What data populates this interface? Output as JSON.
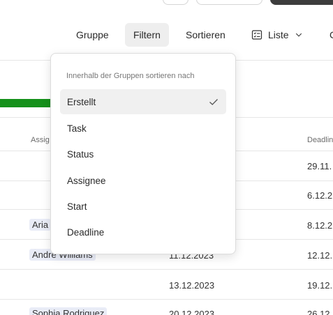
{
  "toolbar": {
    "group_label": "Gruppe",
    "filter_label": "Filtern",
    "sort_label": "Sortieren",
    "view_label": "Liste",
    "view_icon": "list-view-icon",
    "chevron_icon": "chevron-down-icon"
  },
  "table": {
    "headers": {
      "assignee": "Assig",
      "deadline": "Deadlin"
    },
    "rows": [
      {
        "assignee": "",
        "start": "",
        "deadline": "29.11."
      },
      {
        "assignee": "",
        "start": "",
        "deadline": "6.12.2"
      },
      {
        "assignee": "Aria",
        "start": "",
        "deadline": "8.12.2"
      },
      {
        "assignee": "Andre Williams",
        "start": "11.12.2023",
        "deadline": "12.12."
      },
      {
        "assignee": "",
        "start": "13.12.2023",
        "deadline": "19.12."
      },
      {
        "assignee": "Sophia Rodriguez",
        "start": "20.12.2023",
        "deadline": "26.12."
      }
    ]
  },
  "sort_menu": {
    "title": "Innerhalb der Gruppen sortieren nach",
    "items": [
      {
        "label": "Erstellt",
        "selected": true
      },
      {
        "label": "Task",
        "selected": false
      },
      {
        "label": "Status",
        "selected": false
      },
      {
        "label": "Assignee",
        "selected": false
      },
      {
        "label": "Start",
        "selected": false
      },
      {
        "label": "Deadline",
        "selected": false
      }
    ],
    "check_icon": "check-icon"
  },
  "colors": {
    "progress": "#15901a",
    "chip_bg": "#e9ecf7",
    "active_bg": "#eeeeee"
  }
}
